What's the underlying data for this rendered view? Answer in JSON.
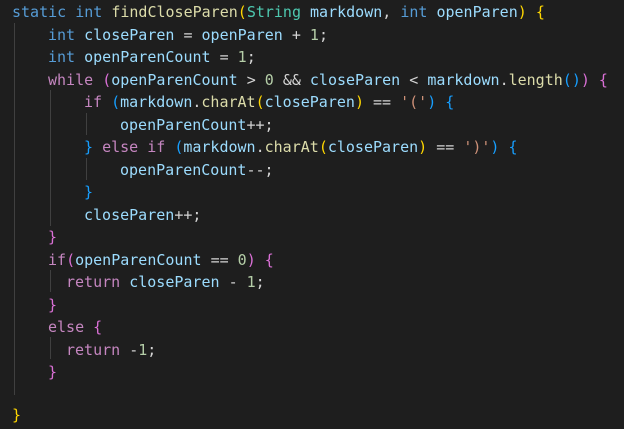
{
  "code": {
    "l1": {
      "kw_static": "static",
      "kw_int": "int",
      "fn": "findCloseParen",
      "open_paren": "(",
      "type_string": "String",
      "param1": "markdown",
      "comma": ",",
      "kw_int2": "int",
      "param2": "openParen",
      "close_paren": ")",
      "brace": "{"
    },
    "l2": {
      "kw": "int",
      "var": "closeParen",
      "op1": "=",
      "var2": "openParen",
      "op2": "+",
      "num": "1",
      "semi": ";"
    },
    "l3": {
      "kw": "int",
      "var": "openParenCount",
      "op": "=",
      "num": "1",
      "semi": ";"
    },
    "l4": {
      "ctl": "while",
      "p_open": "(",
      "var1": "openParenCount",
      "op1": ">",
      "num": "0",
      "op2": "&&",
      "var2": "closeParen",
      "op3": "<",
      "var3": "markdown",
      "dot": ".",
      "fn": "length",
      "call_open": "(",
      "call_close": ")",
      "p_close": ")",
      "brace": "{"
    },
    "l5": {
      "ctl": "if",
      "p_open": "(",
      "var": "markdown",
      "dot": ".",
      "fn": "charAt",
      "call_open": "(",
      "arg": "closeParen",
      "call_close": ")",
      "op": "==",
      "str": "'('",
      "p_close": ")",
      "brace": "{"
    },
    "l6": {
      "var": "openParenCount",
      "op": "++",
      "semi": ";"
    },
    "l7": {
      "brace_close": "}",
      "ctl1": "else",
      "ctl2": "if",
      "p_open": "(",
      "var": "markdown",
      "dot": ".",
      "fn": "charAt",
      "call_open": "(",
      "arg": "closeParen",
      "call_close": ")",
      "op": "==",
      "str": "')'",
      "p_close": ")",
      "brace": "{"
    },
    "l8": {
      "var": "openParenCount",
      "op": "--",
      "semi": ";"
    },
    "l9": {
      "brace": "}"
    },
    "l10": {
      "var": "closeParen",
      "op": "++",
      "semi": ";"
    },
    "l11": {
      "brace": "}"
    },
    "l12": {
      "ctl": "if",
      "p_open": "(",
      "var": "openParenCount",
      "op": "==",
      "num": "0",
      "p_close": ")",
      "brace": "{"
    },
    "l13": {
      "ctl": "return",
      "var": "closeParen",
      "op": "-",
      "num": "1",
      "semi": ";"
    },
    "l14": {
      "brace": "}"
    },
    "l15": {
      "ctl": "else",
      "brace": "{"
    },
    "l16": {
      "ctl": "return",
      "op": "-",
      "num": "1",
      "semi": ";"
    },
    "l17": {
      "brace": "}"
    },
    "l18": {
      "brace": "}"
    }
  }
}
